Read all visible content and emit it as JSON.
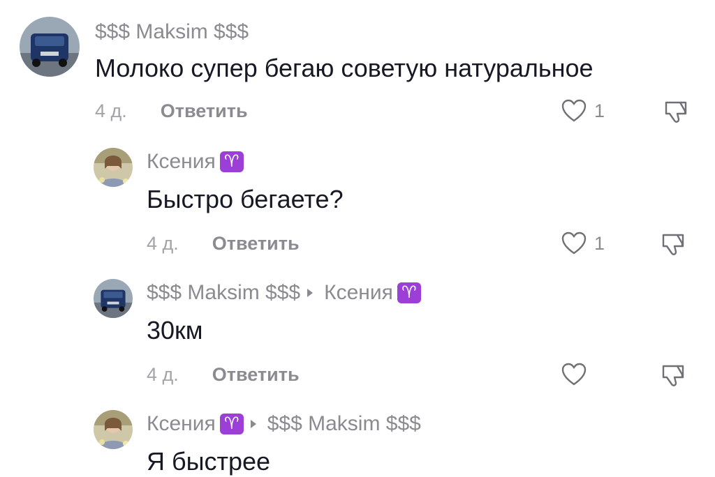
{
  "icons": {
    "like": "heart-outline-icon",
    "dislike": "thumbs-down-outline-icon",
    "aries": "aries-zodiac-emoji"
  },
  "colors": {
    "author": "#8a8b91",
    "text": "#161823",
    "time": "#a3a4a9",
    "aries_badge": "#9b3fd6"
  },
  "comments": [
    {
      "author": "$$$ Maksim $$$",
      "text": "Молоко супер бегаю советую натуральное",
      "time": "4 д.",
      "reply_label": "Ответить",
      "likes": "1"
    },
    {
      "author": "Ксения",
      "badge": "♈",
      "text": "Быстро бегаете?",
      "time": "4 д.",
      "reply_label": "Ответить",
      "likes": "1"
    },
    {
      "author": "$$$ Maksim $$$",
      "reply_to": "Ксения",
      "reply_to_badge": "♈",
      "text": "30км",
      "time": "4 д.",
      "reply_label": "Ответить",
      "likes": ""
    },
    {
      "author": "Ксения",
      "badge": "♈",
      "reply_to": "$$$ Maksim $$$",
      "text": "Я быстрее"
    }
  ]
}
